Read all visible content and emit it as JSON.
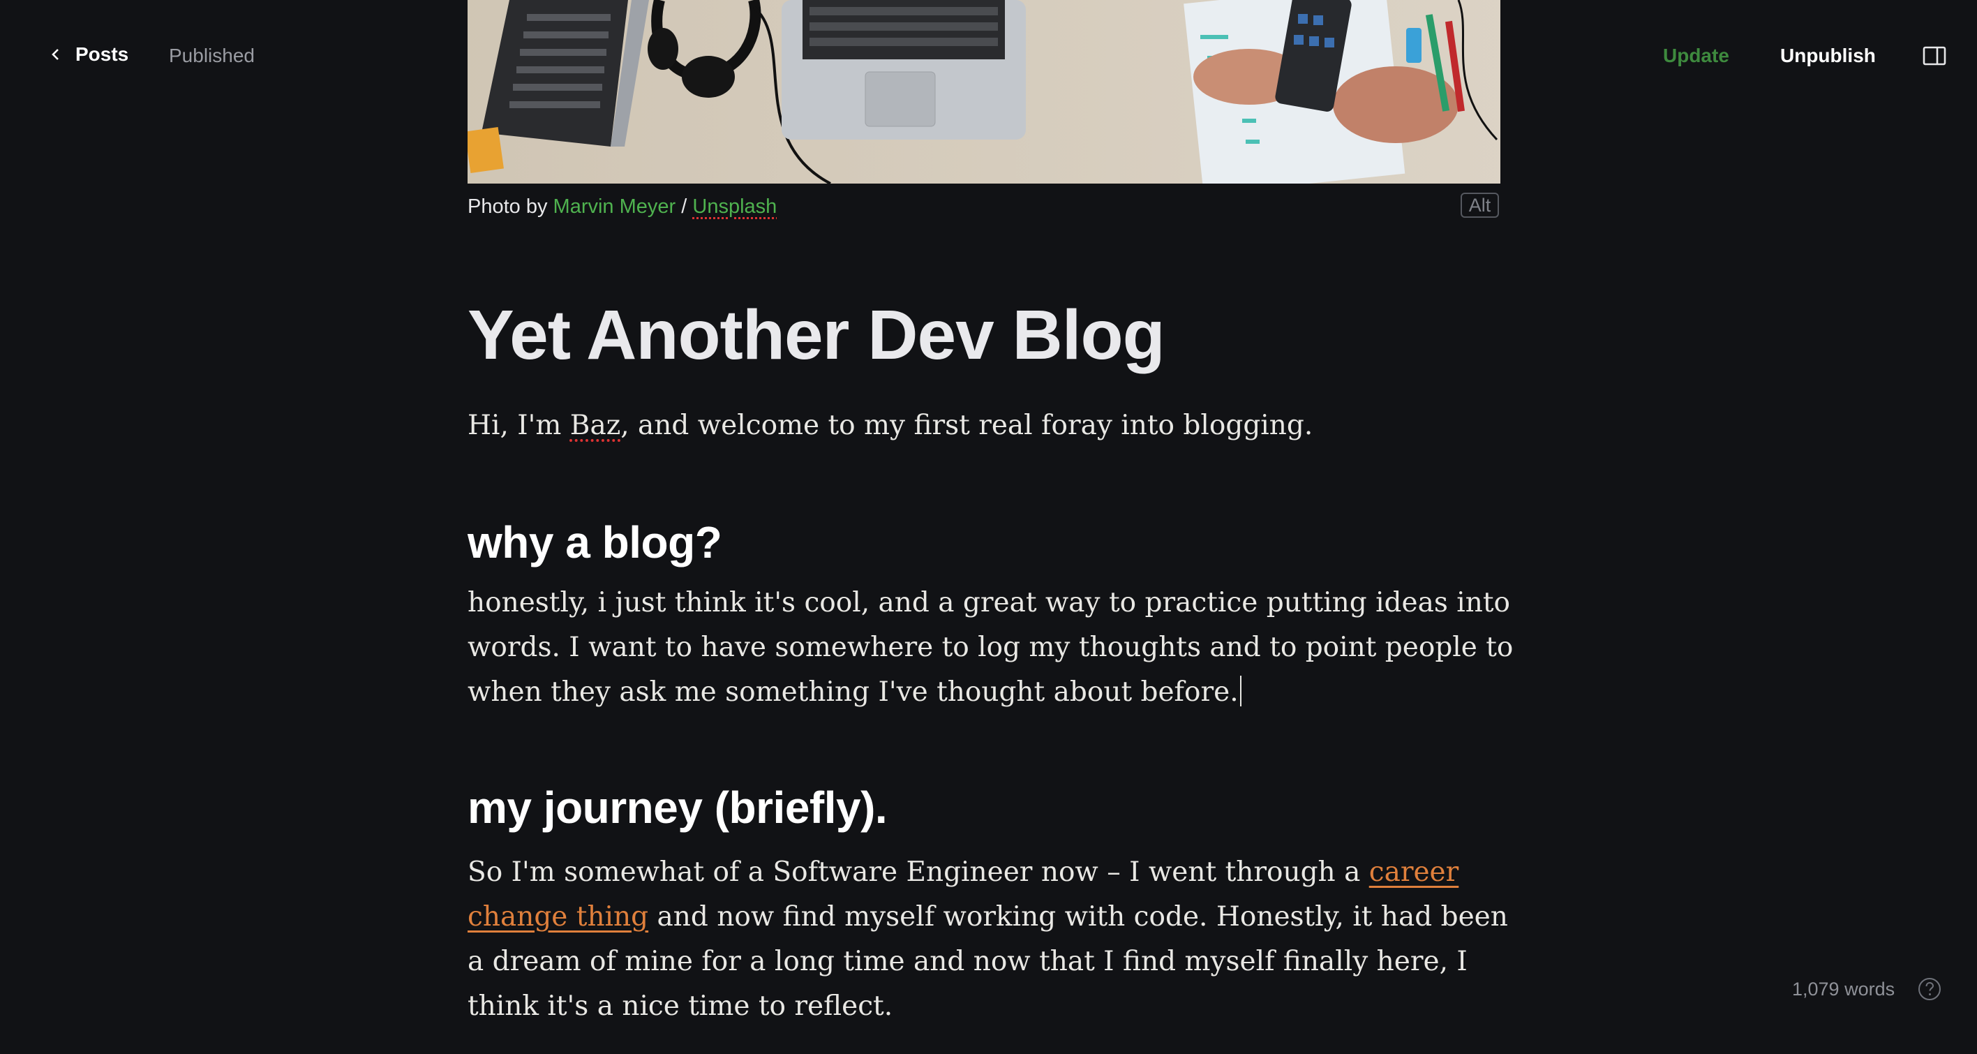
{
  "topbar": {
    "back_label": "Posts",
    "status": "Published",
    "update_label": "Update",
    "unpublish_label": "Unpublish",
    "back_icon": "chevron-left-icon",
    "sidebar_icon": "sidebar-toggle-icon"
  },
  "image": {
    "caption_prefix": "Photo by",
    "author": "Marvin Meyer",
    "separator": "/",
    "source": "Unsplash",
    "alt_label": "Alt"
  },
  "post": {
    "title": "Yet Another Dev Blog",
    "intro_before": "Hi, I'm",
    "intro_name": "Baz",
    "intro_after": ", and welcome to my first real foray into blogging.",
    "h2_1": "why a blog?",
    "p1": "honestly, i just think it's cool, and a great way to practice putting ideas into words. I want to have somewhere to log my thoughts and to point people to when they ask me something I've thought about before.",
    "h2_2": "my journey (briefly).",
    "p2_before": "So I'm somewhat of a Software Engineer now – I went through a",
    "p2_link": "career change thing",
    "p2_after": "and now find myself working with code. Honestly, it had been a dream of mine for a long time and now that I find myself finally here, I think it's a nice time to reflect."
  },
  "footer": {
    "word_count": "1,079 words",
    "help_icon": "help-circle-icon"
  },
  "colors": {
    "background": "#111215",
    "accent_green": "#4fb24f",
    "update_green": "#3e8a3e",
    "link_orange": "#e0803c"
  }
}
